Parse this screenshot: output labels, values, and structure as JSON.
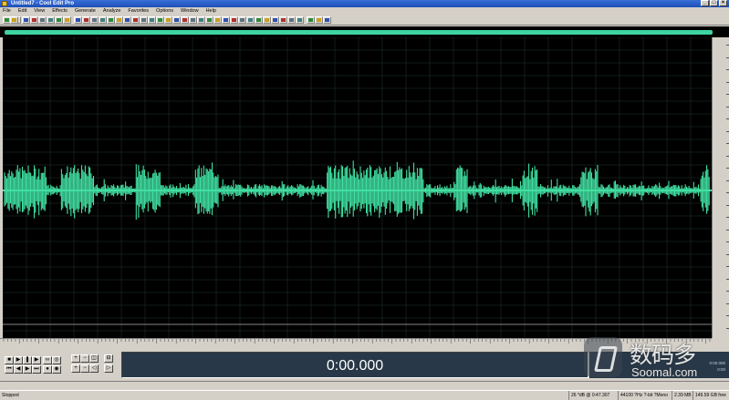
{
  "window": {
    "title": "Untitled7 - Cool Edit Pro"
  },
  "menu": [
    "File",
    "Edit",
    "View",
    "Effects",
    "Generate",
    "Analyze",
    "Favorites",
    "Options",
    "Window",
    "Help"
  ],
  "time_display": "0:00.000",
  "selection_panel": {
    "begin_label": "0:00.000",
    "end_label": "0:00"
  },
  "status": {
    "state": "Stopped",
    "level": "26 *dB @ 0:47.307",
    "format": "44100 ?Hz ?-bit ?Mono",
    "size": "2.39 MB",
    "free": "149.59 GB free"
  },
  "watermark": {
    "cn": "数码多",
    "url": "Soomal.com"
  },
  "colors": {
    "waveform": "#41e0a2",
    "background": "#000000",
    "grid": "#1e3a2c"
  },
  "icons": {
    "window_min": "minimize-icon",
    "window_max": "maximize-icon",
    "window_close": "close-icon"
  }
}
